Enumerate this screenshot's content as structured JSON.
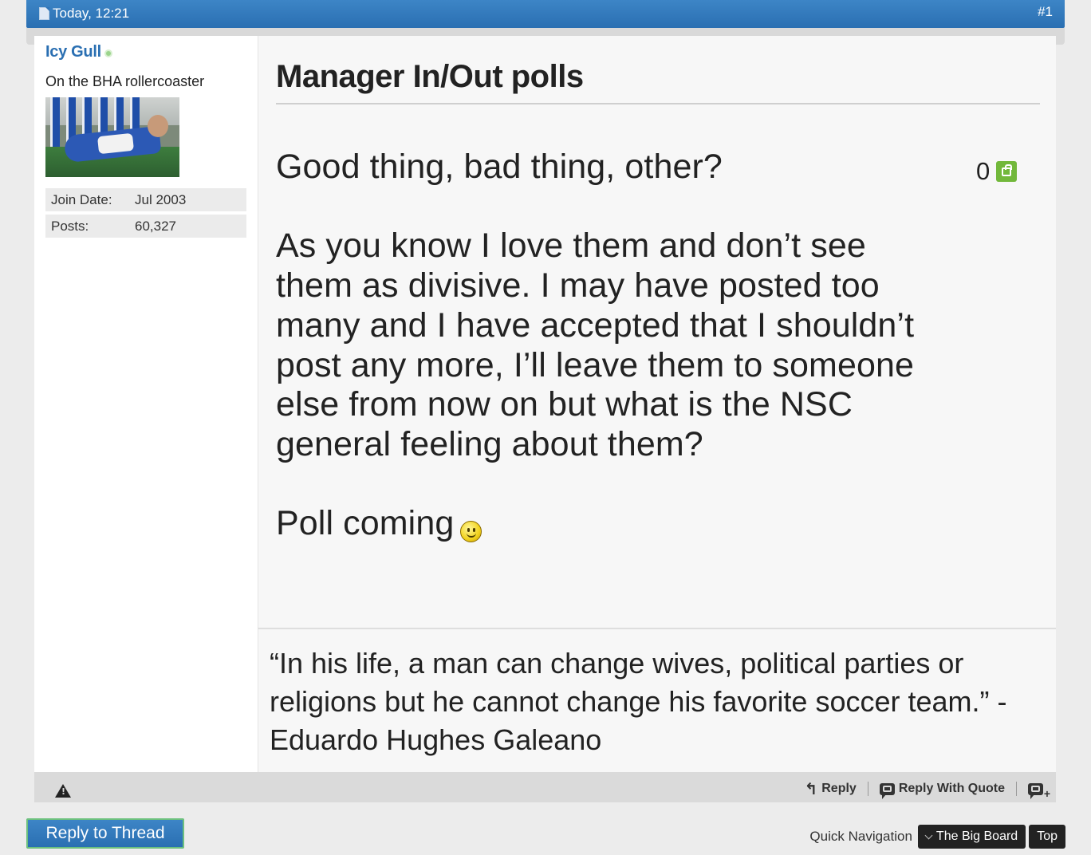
{
  "post": {
    "date": "Today, 12:21",
    "number": "#1",
    "title": "Manager In/Out polls",
    "likes": "0",
    "paragraphs": [
      "Good thing, bad thing, other?",
      "As you know I love them and don’t see them as divisive. I may have posted too many and I have accepted that I shouldn’t post any more, I’ll leave them to someone else from now on but what is the NSC general feeling about them?",
      "Poll coming"
    ],
    "signature": "“In his life, a man can change wives, political parties or religions but he cannot change his favorite soccer team.” - Eduardo Hughes Galeano"
  },
  "user": {
    "name": "Icy Gull",
    "title": "On the BHA rollercoaster",
    "join_date_label": "Join Date:",
    "join_date": "Jul 2003",
    "posts_label": "Posts:",
    "posts": "60,327"
  },
  "actions": {
    "reply": "Reply",
    "reply_with_quote": "Reply With Quote"
  },
  "footer": {
    "reply_to_thread": "Reply to Thread",
    "quick_navigation": "Quick Navigation",
    "forum": "The Big Board",
    "top": "Top"
  },
  "colors": {
    "header_blue": "#2f75b9",
    "username_blue": "#2a6fb2",
    "like_green": "#72b83b",
    "online_green": "#9bd48c"
  },
  "icons": [
    "document-icon",
    "online-status-icon",
    "like-icon",
    "smiley-icon",
    "warning-icon",
    "reply-icon",
    "reply-with-quote-icon",
    "multi-quote-icon",
    "chevron-down-icon"
  ]
}
